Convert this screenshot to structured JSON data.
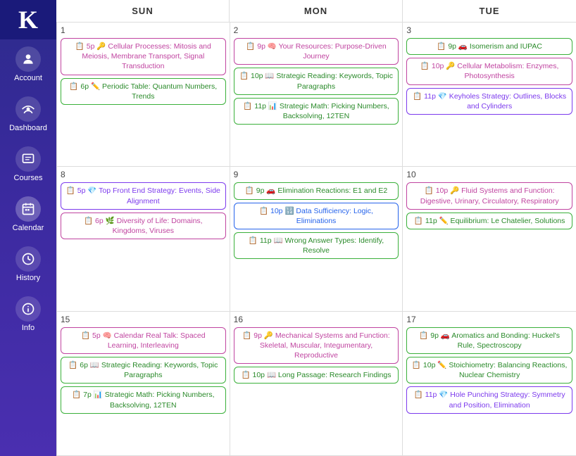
{
  "sidebar": {
    "logo": "K",
    "items": [
      {
        "id": "account",
        "label": "Account",
        "icon": "account"
      },
      {
        "id": "dashboard",
        "label": "Dashboard",
        "icon": "dashboard"
      },
      {
        "id": "courses",
        "label": "Courses",
        "icon": "courses"
      },
      {
        "id": "calendar",
        "label": "Calendar",
        "icon": "calendar",
        "active": true
      },
      {
        "id": "history",
        "label": "History",
        "icon": "history"
      },
      {
        "id": "info",
        "label": "Info",
        "icon": "info"
      }
    ]
  },
  "calendar": {
    "headers": [
      "SUN",
      "MON",
      "TUE"
    ],
    "rows": [
      {
        "cells": [
          {
            "day": "1",
            "events": [
              {
                "type": "bio",
                "label": "📋 5p 🔑 Cellular Processes: Mitosis and Meiosis, Membrane Transport, Signal Transduction"
              },
              {
                "type": "green",
                "label": "📋 6p ✏️ Periodic Table: Quantum Numbers, Trends"
              }
            ]
          },
          {
            "day": "2",
            "events": [
              {
                "type": "bio",
                "label": "📋 9p 🧠 Your Resources: Purpose-Driven Journey"
              },
              {
                "type": "green",
                "label": "📋 10p 📖 Strategic Reading: Keywords, Topic Paragraphs"
              },
              {
                "type": "green",
                "label": "📋 11p 📊 Strategic Math: Picking Numbers, Backsolving, 12TEN"
              }
            ]
          },
          {
            "day": "3",
            "events": [
              {
                "type": "green",
                "label": "📋 9p 🚗 Isomerism and IUPAC"
              },
              {
                "type": "bio",
                "label": "📋 10p 🔑 Cellular Metabolism: Enzymes, Photosynthesis"
              },
              {
                "type": "purple",
                "label": "📋 11p 💎 Keyholes Strategy: Outlines, Blocks and Cylinders"
              }
            ]
          }
        ]
      },
      {
        "cells": [
          {
            "day": "8",
            "events": [
              {
                "type": "purple",
                "label": "📋 5p 💎 Top Front End Strategy: Events, Side Alignment"
              },
              {
                "type": "bio",
                "label": "📋 6p 🌿 Diversity of Life: Domains, Kingdoms, Viruses"
              }
            ]
          },
          {
            "day": "9",
            "events": [
              {
                "type": "green",
                "label": "📋 9p 🚗 Elimination Reactions: E1 and E2"
              },
              {
                "type": "blue",
                "label": "📋 10p 🔢 Data Sufficiency: Logic, Eliminations"
              },
              {
                "type": "green",
                "label": "📋 11p 📖 Wrong Answer Types: Identify, Resolve"
              }
            ]
          },
          {
            "day": "10",
            "events": [
              {
                "type": "bio",
                "label": "📋 10p 🔑 Fluid Systems and Function: Digestive, Urinary, Circulatory, Respiratory"
              },
              {
                "type": "green",
                "label": "📋 11p ✏️ Equilibrium: Le Chatelier, Solutions"
              }
            ]
          }
        ]
      },
      {
        "cells": [
          {
            "day": "15",
            "events": [
              {
                "type": "bio",
                "label": "📋 5p 🧠 Calendar Real Talk: Spaced Learning, Interleaving"
              },
              {
                "type": "green",
                "label": "📋 6p 📖 Strategic Reading: Keywords, Topic Paragraphs"
              },
              {
                "type": "green",
                "label": "📋 7p 📊 Strategic Math: Picking Numbers, Backsolving, 12TEN"
              }
            ]
          },
          {
            "day": "16",
            "events": [
              {
                "type": "bio",
                "label": "📋 9p 🔑 Mechanical Systems and Function: Skeletal, Muscular, Integumentary, Reproductive"
              },
              {
                "type": "green",
                "label": "📋 10p 📖 Long Passage: Research Findings"
              }
            ]
          },
          {
            "day": "17",
            "events": [
              {
                "type": "green",
                "label": "📋 9p 🚗 Aromatics and Bonding: Huckel's Rule, Spectroscopy"
              },
              {
                "type": "green",
                "label": "📋 10p ✏️ Stoichiometry: Balancing Reactions, Nuclear Chemistry"
              },
              {
                "type": "purple",
                "label": "📋 11p 💎 Hole Punching Strategy: Symmetry and Position, Elimination"
              }
            ]
          }
        ]
      }
    ]
  }
}
